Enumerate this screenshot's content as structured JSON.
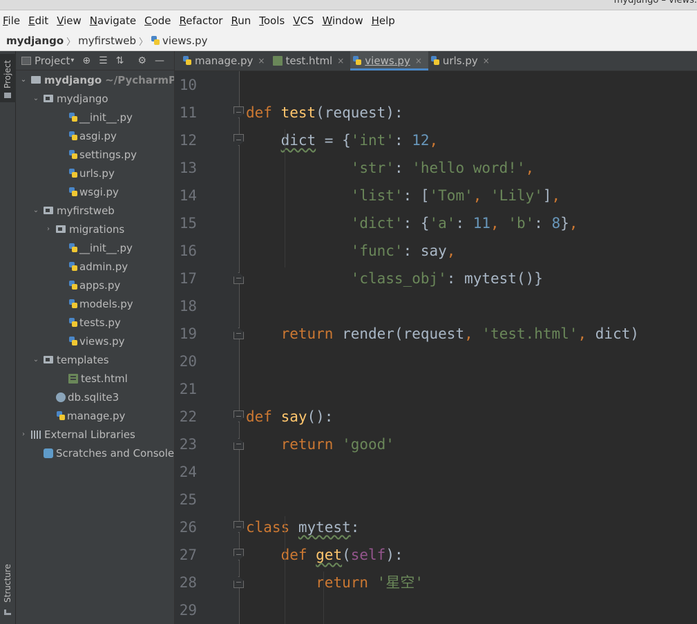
{
  "window": {
    "title": "mydjango – views."
  },
  "menu": [
    {
      "mn": "F",
      "rest": "ile"
    },
    {
      "mn": "E",
      "rest": "dit"
    },
    {
      "mn": "V",
      "rest": "iew"
    },
    {
      "mn": "N",
      "rest": "avigate"
    },
    {
      "mn": "C",
      "rest": "ode"
    },
    {
      "mn": "R",
      "rest": "efactor"
    },
    {
      "mn": "R",
      "rest": "un"
    },
    {
      "mn": "T",
      "rest": "ools"
    },
    {
      "mn": "V",
      "rest": "CS"
    },
    {
      "mn": "W",
      "rest": "indow"
    },
    {
      "mn": "H",
      "rest": "elp"
    }
  ],
  "breadcrumb": {
    "root": "mydjango",
    "mid": "myfirstweb",
    "file": "views.py",
    "sep": "〉"
  },
  "side_tabs": {
    "project": "Project",
    "structure": "Structure"
  },
  "project_panel": {
    "title": "Project",
    "tools": [
      "⊕",
      "☰",
      "⇅",
      "⚙",
      "—"
    ],
    "tree": [
      {
        "label": "mydjango",
        "path": "~/PycharmProj",
        "arrow": "⌄",
        "icon": "folder",
        "bold": true
      },
      {
        "label": "mydjango",
        "arrow": "⌄",
        "icon": "folder"
      },
      {
        "label": "__init__.py",
        "icon": "py"
      },
      {
        "label": "asgi.py",
        "icon": "py"
      },
      {
        "label": "settings.py",
        "icon": "py"
      },
      {
        "label": "urls.py",
        "icon": "py"
      },
      {
        "label": "wsgi.py",
        "icon": "py"
      },
      {
        "label": "myfirstweb",
        "arrow": "⌄",
        "icon": "folder"
      },
      {
        "label": "migrations",
        "arrow": "›",
        "icon": "folder"
      },
      {
        "label": "__init__.py",
        "icon": "py"
      },
      {
        "label": "admin.py",
        "icon": "py"
      },
      {
        "label": "apps.py",
        "icon": "py"
      },
      {
        "label": "models.py",
        "icon": "py"
      },
      {
        "label": "tests.py",
        "icon": "py"
      },
      {
        "label": "views.py",
        "icon": "py"
      },
      {
        "label": "templates",
        "arrow": "⌄",
        "icon": "folder"
      },
      {
        "label": "test.html",
        "icon": "html"
      },
      {
        "label": "db.sqlite3",
        "icon": "db"
      },
      {
        "label": "manage.py",
        "icon": "py"
      },
      {
        "label": "External Libraries",
        "arrow": "›",
        "icon": "lib"
      },
      {
        "label": "Scratches and Consoles",
        "icon": "scratch"
      }
    ]
  },
  "tabs": [
    {
      "label": "manage.py",
      "icon": "py",
      "active": false
    },
    {
      "label": "test.html",
      "icon": "html",
      "active": false
    },
    {
      "label": "views.py",
      "icon": "py",
      "active": true
    },
    {
      "label": "urls.py",
      "icon": "py",
      "active": false
    }
  ],
  "tab_close": "×",
  "editor": {
    "line_numbers": [
      "10",
      "11",
      "12",
      "13",
      "14",
      "15",
      "16",
      "17",
      "18",
      "19",
      "20",
      "21",
      "22",
      "23",
      "24",
      "25",
      "26",
      "27",
      "28",
      "29"
    ],
    "code": {
      "l10": [],
      "l11": [
        [
          "k",
          "def "
        ],
        [
          "f",
          "test"
        ],
        [
          "",
          "(request):"
        ]
      ],
      "l12": [
        [
          "",
          "    "
        ],
        [
          "w",
          "dict"
        ],
        [
          "",
          " = {"
        ],
        [
          "s",
          "'int'"
        ],
        [
          "",
          ": "
        ],
        [
          "n",
          "12"
        ],
        [
          "k",
          ","
        ]
      ],
      "l13": [
        [
          "",
          "            "
        ],
        [
          "s",
          "'str'"
        ],
        [
          "",
          ": "
        ],
        [
          "s",
          "'hello word!'"
        ],
        [
          "k",
          ","
        ]
      ],
      "l14": [
        [
          "",
          "            "
        ],
        [
          "s",
          "'list'"
        ],
        [
          "",
          ": ["
        ],
        [
          "s",
          "'Tom'"
        ],
        [
          "k",
          ", "
        ],
        [
          "s",
          "'Lily'"
        ],
        [
          "",
          "]"
        ],
        [
          "k",
          ","
        ]
      ],
      "l15": [
        [
          "",
          "            "
        ],
        [
          "s",
          "'dict'"
        ],
        [
          "",
          ": {"
        ],
        [
          "s",
          "'a'"
        ],
        [
          "",
          ": "
        ],
        [
          "n",
          "11"
        ],
        [
          "k",
          ", "
        ],
        [
          "s",
          "'b'"
        ],
        [
          "",
          ": "
        ],
        [
          "n",
          "8"
        ],
        [
          "",
          "}"
        ],
        [
          "k",
          ","
        ]
      ],
      "l16": [
        [
          "",
          "            "
        ],
        [
          "s",
          "'func'"
        ],
        [
          "",
          ": say"
        ],
        [
          "k",
          ","
        ]
      ],
      "l17": [
        [
          "",
          "            "
        ],
        [
          "s",
          "'class_obj'"
        ],
        [
          "",
          ": mytest()}"
        ]
      ],
      "l18": [],
      "l19": [
        [
          "",
          "    "
        ],
        [
          "k",
          "return "
        ],
        [
          "",
          "render(request"
        ],
        [
          "k",
          ", "
        ],
        [
          "s",
          "'test.html'"
        ],
        [
          "k",
          ", "
        ],
        [
          "",
          "dict)"
        ]
      ],
      "l20": [],
      "l21": [],
      "l22": [
        [
          "k",
          "def "
        ],
        [
          "f",
          "say"
        ],
        [
          "",
          "():"
        ]
      ],
      "l23": [
        [
          "",
          "    "
        ],
        [
          "k",
          "return "
        ],
        [
          "s",
          "'good'"
        ]
      ],
      "l24": [],
      "l25": [],
      "l26": [
        [
          "k",
          "class "
        ],
        [
          "w",
          "mytest"
        ],
        [
          "",
          ":"
        ]
      ],
      "l27": [
        [
          "",
          "    "
        ],
        [
          "k",
          "def "
        ],
        [
          "fw",
          "get"
        ],
        [
          "",
          "("
        ],
        [
          "p",
          "self"
        ],
        [
          "",
          "):"
        ]
      ],
      "l28": [
        [
          "",
          "        "
        ],
        [
          "k",
          "return "
        ],
        [
          "s",
          "'星空'"
        ]
      ],
      "l29": []
    }
  },
  "colors": {
    "keyword": "#cc7832",
    "function": "#ffc66d",
    "string": "#6a8759",
    "number": "#6897bb",
    "self": "#94558d",
    "text": "#a9b7c6",
    "tab_underline": "#4a88c7"
  }
}
